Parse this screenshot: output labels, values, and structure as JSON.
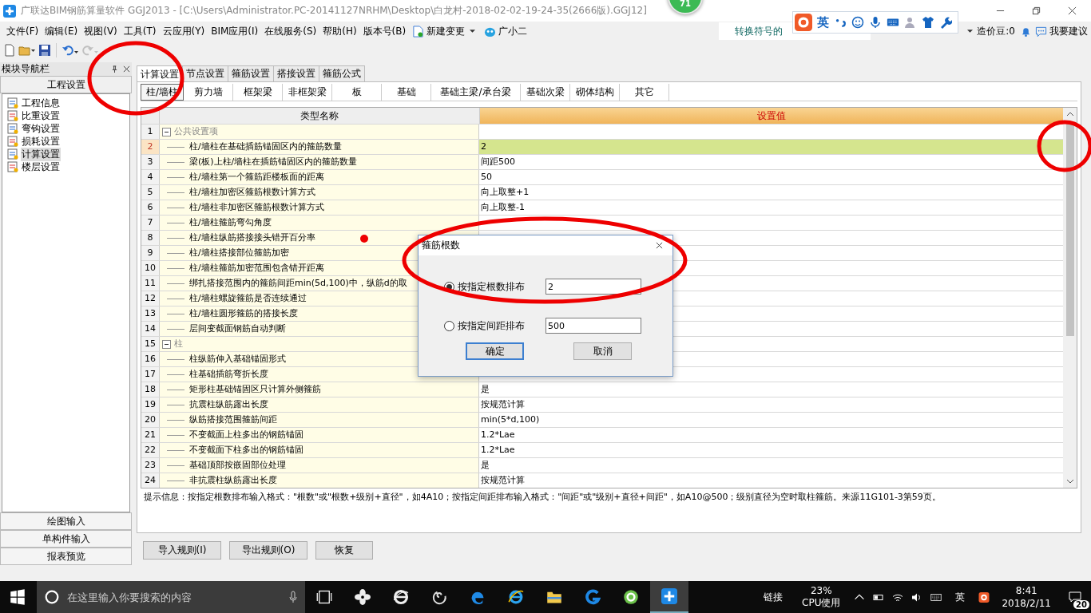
{
  "window": {
    "title": "广联达BIM钢筋算量软件 GGJ2013 - [C:\\Users\\Administrator.PC-20141127NRHM\\Desktop\\白龙村-2018-02-02-19-24-35(2666版).GGJ12]"
  },
  "floating_badge": "71",
  "ime_bar": {
    "mode": "英"
  },
  "menu": [
    "文件(F)",
    "编辑(E)",
    "视图(V)",
    "工具(T)",
    "云应用(Y)",
    "BIM应用(I)",
    "在线服务(S)",
    "帮助(H)",
    "版本号(B)"
  ],
  "menu_extras": {
    "new_change": "新建变更",
    "assistant": "广小二",
    "tip": "转换符号的",
    "beans": "造价豆:0",
    "suggest": "我要建议"
  },
  "toolbar": [
    {
      "kind": "new",
      "disabled": false
    },
    {
      "kind": "open",
      "disabled": false
    },
    {
      "kind": "save",
      "disabled": false
    },
    {
      "kind": "undo",
      "disabled": false
    },
    {
      "kind": "redo",
      "disabled": true
    }
  ],
  "navigator": {
    "title": "模块导航栏",
    "section": "工程设置",
    "items": [
      {
        "label": "工程信息",
        "selected": false
      },
      {
        "label": "比重设置",
        "selected": false
      },
      {
        "label": "弯钩设置",
        "selected": false
      },
      {
        "label": "损耗设置",
        "selected": false
      },
      {
        "label": "计算设置",
        "selected": true
      },
      {
        "label": "楼层设置",
        "selected": false
      }
    ],
    "bottom": [
      "绘图输入",
      "单构件输入",
      "报表预览"
    ]
  },
  "tabs": [
    {
      "label": "计算设置",
      "selected": true
    },
    {
      "label": "节点设置",
      "selected": false
    },
    {
      "label": "箍筋设置",
      "selected": false
    },
    {
      "label": "搭接设置",
      "selected": false
    },
    {
      "label": "箍筋公式",
      "selected": false
    }
  ],
  "subtabs": [
    {
      "label": "柱/墙柱",
      "selected": true
    },
    {
      "label": "剪力墙",
      "selected": false
    },
    {
      "label": "框架梁",
      "selected": false
    },
    {
      "label": "非框架梁",
      "selected": false
    },
    {
      "label": "板",
      "selected": false
    },
    {
      "label": "基础",
      "selected": false
    },
    {
      "label": "基础主梁/承台梁",
      "selected": false
    },
    {
      "label": "基础次梁",
      "selected": false
    },
    {
      "label": "砌体结构",
      "selected": false
    },
    {
      "label": "其它",
      "selected": false
    }
  ],
  "table": {
    "columns": [
      "类型名称",
      "设置值"
    ],
    "groups": [
      {
        "number": "1",
        "name": "公共设置项",
        "expanded": true,
        "children": [
          {
            "number": "2",
            "name": "柱/墙柱在基础插筋锚固区内的箍筋数量",
            "value": "2",
            "selected": true
          },
          {
            "number": "3",
            "name": "梁(板)上柱/墙柱在插筋锚固区内的箍筋数量",
            "value": "间距500",
            "selected": false
          },
          {
            "number": "4",
            "name": "柱/墙柱第一个箍筋距楼板面的距离",
            "value": "50",
            "selected": false
          },
          {
            "number": "5",
            "name": "柱/墙柱加密区箍筋根数计算方式",
            "value": "向上取整+1",
            "selected": false
          },
          {
            "number": "6",
            "name": "柱/墙柱非加密区箍筋根数计算方式",
            "value": "向上取整-1",
            "selected": false
          },
          {
            "number": "7",
            "name": "柱/墙柱箍筋弯勾角度",
            "selected": false
          },
          {
            "number": "8",
            "name": "柱/墙柱纵筋搭接接头错开百分率",
            "selected": false
          },
          {
            "number": "9",
            "name": "柱/墙柱搭接部位箍筋加密",
            "selected": false
          },
          {
            "number": "10",
            "name": "柱/墙柱箍筋加密范围包含错开距离",
            "selected": false
          },
          {
            "number": "11",
            "name": "绑扎搭接范围内的箍筋间距min(5d,100)中，纵筋d的取",
            "selected": false
          },
          {
            "number": "12",
            "name": "柱/墙柱螺旋箍筋是否连续通过",
            "selected": false
          },
          {
            "number": "13",
            "name": "柱/墙柱圆形箍筋的搭接长度",
            "selected": false
          },
          {
            "number": "14",
            "name": "层间变截面钢筋自动判断",
            "selected": false
          }
        ]
      },
      {
        "number": "15",
        "name": "柱",
        "expanded": true,
        "children": [
          {
            "number": "16",
            "name": "柱纵筋伸入基础锚固形式",
            "selected": false
          },
          {
            "number": "17",
            "name": "柱基础插筋弯折长度",
            "selected": false
          },
          {
            "number": "18",
            "name": "矩形柱基础锚固区只计算外侧箍筋",
            "value": "是",
            "selected": false
          },
          {
            "number": "19",
            "name": "抗震柱纵筋露出长度",
            "value": "按规范计算",
            "selected": false
          },
          {
            "number": "20",
            "name": "纵筋搭接范围箍筋间距",
            "value": "min(5*d,100)",
            "selected": false
          },
          {
            "number": "21",
            "name": "不变截面上柱多出的钢筋锚固",
            "value": "1.2*Lae",
            "selected": false
          },
          {
            "number": "22",
            "name": "不变截面下柱多出的钢筋锚固",
            "value": "1.2*Lae",
            "selected": false
          },
          {
            "number": "23",
            "name": "基础顶部按嵌固部位处理",
            "value": "是",
            "selected": false
          },
          {
            "number": "24",
            "name": "非抗震柱纵筋露出长度",
            "value": "按规范计算",
            "selected": false
          }
        ]
      }
    ]
  },
  "hint": "提示信息：按指定根数排布输入格式：\"根数\"或\"根数+级别+直径\"，如4A10；按指定间距排布输入格式：\"间距\"或\"级别+直径+间距\"，如A10@500；级别直径为空时取柱箍筋。来源11G101-3第59页。",
  "buttons": [
    "导入规则(I)",
    "导出规则(O)",
    "恢复"
  ],
  "dialog": {
    "title": "箍筋根数",
    "options": [
      {
        "label": "按指定根数排布",
        "value": "2",
        "selected": true
      },
      {
        "label": "按指定间距排布",
        "value": "500",
        "selected": false
      }
    ],
    "buttons": [
      "确定",
      "取消"
    ]
  },
  "annotations": [
    {
      "kind": "ellipse"
    },
    {
      "kind": "ellipse"
    },
    {
      "kind": "ellipse"
    },
    {
      "kind": "dot"
    }
  ],
  "taskbar": {
    "search_placeholder": "在这里输入你要搜索的内容",
    "link": "链接",
    "cpu_value": "23%",
    "cpu_label": "CPU使用",
    "ime": "英",
    "time": "8:41",
    "date": "2018/2/11",
    "notifications": "20"
  }
}
